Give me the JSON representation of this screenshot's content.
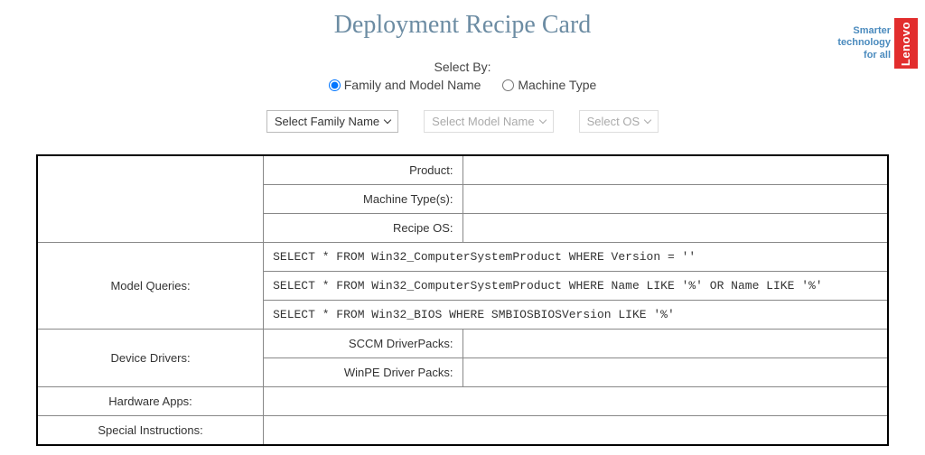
{
  "title": "Deployment Recipe Card",
  "logo": {
    "tagline_line1": "Smarter",
    "tagline_line2": "technology",
    "tagline_line3": "for all",
    "brand": "Lenovo"
  },
  "selectBy": {
    "label": "Select By:",
    "options": [
      {
        "label": "Family and Model Name",
        "checked": true
      },
      {
        "label": "Machine Type",
        "checked": false
      }
    ]
  },
  "selects": {
    "family": "Select Family Name",
    "model": "Select Model Name",
    "os": "Select OS"
  },
  "infoRows": {
    "product": {
      "label": "Product:",
      "value": ""
    },
    "machineTypes": {
      "label": "Machine Type(s):",
      "value": ""
    },
    "recipeOs": {
      "label": "Recipe OS:",
      "value": ""
    }
  },
  "modelQueries": {
    "label": "Model Queries:",
    "queries": [
      "SELECT * FROM Win32_ComputerSystemProduct WHERE Version = ''",
      "SELECT * FROM Win32_ComputerSystemProduct WHERE Name LIKE '%' OR Name LIKE '%'",
      "SELECT * FROM Win32_BIOS WHERE SMBIOSBIOSVersion LIKE '%'"
    ]
  },
  "deviceDrivers": {
    "label": "Device Drivers:",
    "sccm": {
      "label": "SCCM DriverPacks:",
      "value": ""
    },
    "winpe": {
      "label": "WinPE Driver Packs:",
      "value": ""
    }
  },
  "hardwareApps": {
    "label": "Hardware Apps:",
    "value": ""
  },
  "specialInstructions": {
    "label": "Special Instructions:",
    "value": ""
  }
}
